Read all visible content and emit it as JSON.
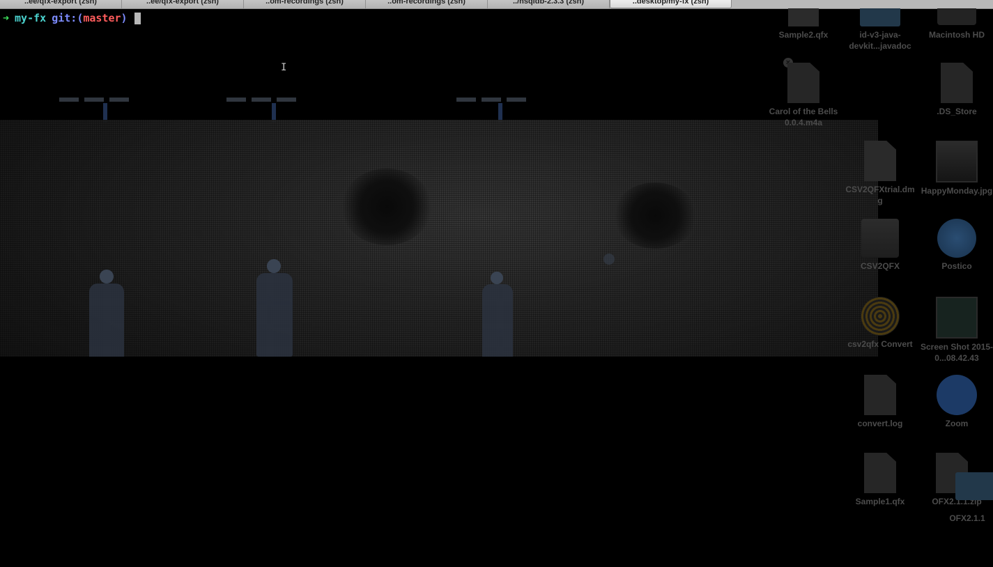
{
  "tabs": [
    {
      "label": "..ee/qfx-export (zsh)",
      "active": false
    },
    {
      "label": "..ee/qfx-export (zsh)",
      "active": false
    },
    {
      "label": "..om-recordings (zsh)",
      "active": false
    },
    {
      "label": "..om-recordings (zsh)",
      "active": false
    },
    {
      "label": "../hsqldb-2.3.3 (zsh)",
      "active": false
    },
    {
      "label": "..desktop/my-fx (zsh)",
      "active": true
    }
  ],
  "prompt": {
    "arrow": "➜",
    "directory": "my-fx",
    "git_label": "git:",
    "open_paren": "(",
    "branch": "master",
    "close_paren": ")"
  },
  "desktop": {
    "icons": [
      {
        "label": "Sample2.qfx",
        "icon": "document-icon"
      },
      {
        "label": "id-v3-java-devkit...javadoc",
        "icon": "folder-icon"
      },
      {
        "label": "Macintosh HD",
        "icon": "hard-drive-icon"
      },
      {
        "label": "Carol of the Bells 0.0.4.m4a",
        "icon": "audio-file-icon"
      },
      {
        "label": ".DS_Store",
        "icon": "document-icon"
      },
      {
        "label": "CSV2QFXtrial.dmg",
        "icon": "disk-image-icon"
      },
      {
        "label": "HappyMonday.jpg",
        "icon": "image-thumbnail-icon"
      },
      {
        "label": "CSV2QFX",
        "icon": "drive-icon"
      },
      {
        "label": "Postico",
        "icon": "elephant-app-icon"
      },
      {
        "label": "csv2qfx Convert",
        "icon": "spiral-app-icon"
      },
      {
        "label": "Screen Shot 2015-0...08.42.43",
        "icon": "screenshot-thumbnail-icon"
      },
      {
        "label": "convert.log",
        "icon": "log-file-icon"
      },
      {
        "label": "Zoom",
        "icon": "zoom-app-icon"
      },
      {
        "label": "Sample1.qfx",
        "icon": "document-icon"
      },
      {
        "label": "OFX2.1.1.zip",
        "icon": "zip-file-icon"
      },
      {
        "label": "OFX2.1.1",
        "icon": "folder-icon"
      }
    ]
  },
  "colors": {
    "prompt_arrow": "#3ee05c",
    "prompt_dir": "#4bd3cf",
    "prompt_git": "#7d8cff",
    "prompt_branch": "#ff5c5c",
    "terminal_bg": "#000000",
    "tab_bar": "#b9b9b9"
  }
}
